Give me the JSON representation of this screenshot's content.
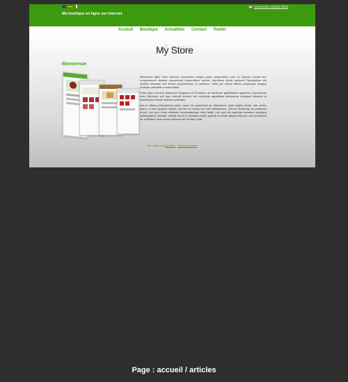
{
  "header": {
    "tagline": "Ma boutique en ligne sur internet",
    "account_link": "Connexion compte client"
  },
  "languages": [
    "en",
    "es",
    "it"
  ],
  "nav": {
    "items": [
      "Acceuil",
      "Boutique",
      "Actualités",
      "Contact",
      "Panier"
    ]
  },
  "logo": {
    "text": "My Store"
  },
  "main": {
    "heading": "Bienvenue",
    "paragraphs": [
      "Metuentes igitur idem latrones Lycaoniam magna parte campestrem cum se inpares nostris fore congressione stataria documentis frequentibus scirent, tramitibus deviis petivere Pamphyliam diu quidem intactam sed timore populationum et caedium, milite per omnia diffuso propinqua, magnis undique praesidiis communitam.",
      "Primi igitur omnium statuuntur Epigonus et Eusebius ob nominum gentilitatem oppressi. praediximus enim Montium sub ipso vivendi termino his vocabulis appellatos fabricarum culpasse tribunos ut adminicula futurae molitioni pollicitos.",
      "Iam in altera philosophiae parte, quae est quaerendi ac disserendi, quae logikê dicitur, iste vester plane, ut mihi quidem videtur, inermis ac nudus est. tollit definitiones, nihil de dividendo ac partiendo docet, non quo modo efficiatur concludaturque ratio tradit, non qua via captiosa solvantur ambigua distinguantur ostendit; iudicia rerum in sensibus ponit, quibus si semel aliquid falsi pro vero probatum sit, sublatum esse omne iudicium veri et falsi putat."
    ]
  },
  "footer": {
    "prefix": "Site réalisé par",
    "link1": "Netsollion",
    "separator": " - ",
    "link2": "Wordland Islande"
  },
  "caption": "Page : accueil / articles",
  "colors": {
    "brand_green": "#3c9a0d",
    "background": "#2e2e2e"
  }
}
